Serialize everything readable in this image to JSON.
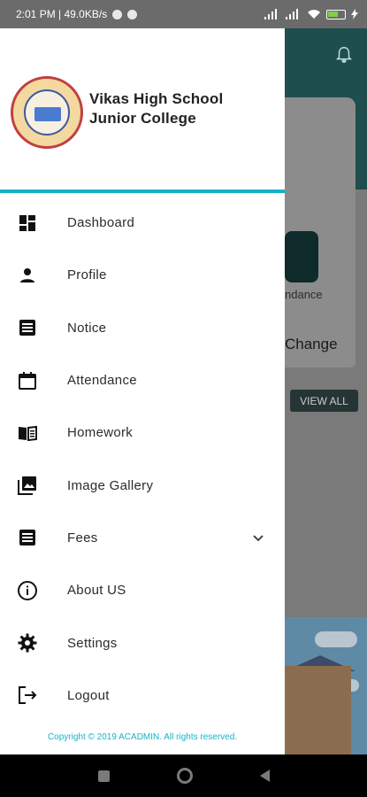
{
  "status_bar": {
    "time_speed": "2:01 PM | 49.0KB/s",
    "battery_level": "",
    "icons": [
      "notification-icon",
      "notification-icon",
      "signal-icon",
      "signal-icon",
      "wifi-icon",
      "battery-icon",
      "charging-icon"
    ]
  },
  "drawer": {
    "school_name_line1": "Vikas High School",
    "school_name_line2": "Junior College",
    "accent_color": "#16b3c8",
    "items": [
      {
        "label": "Dashboard",
        "icon": "dashboard-icon"
      },
      {
        "label": "Profile",
        "icon": "person-icon"
      },
      {
        "label": "Notice",
        "icon": "notice-icon"
      },
      {
        "label": "Attendance",
        "icon": "calendar-icon"
      },
      {
        "label": "Homework",
        "icon": "book-icon"
      },
      {
        "label": "Image Gallery",
        "icon": "gallery-icon"
      },
      {
        "label": "Fees",
        "icon": "fees-icon"
      },
      {
        "label": "About US",
        "icon": "info-icon"
      },
      {
        "label": "Settings",
        "icon": "gear-icon"
      },
      {
        "label": "Logout",
        "icon": "logout-icon"
      }
    ],
    "footer": "Copyright © 2019 ACADMIN. All rights reserved."
  },
  "background": {
    "attendance_label": "ndance",
    "change_label": "Change",
    "view_all_label": "VIEW ALL"
  }
}
